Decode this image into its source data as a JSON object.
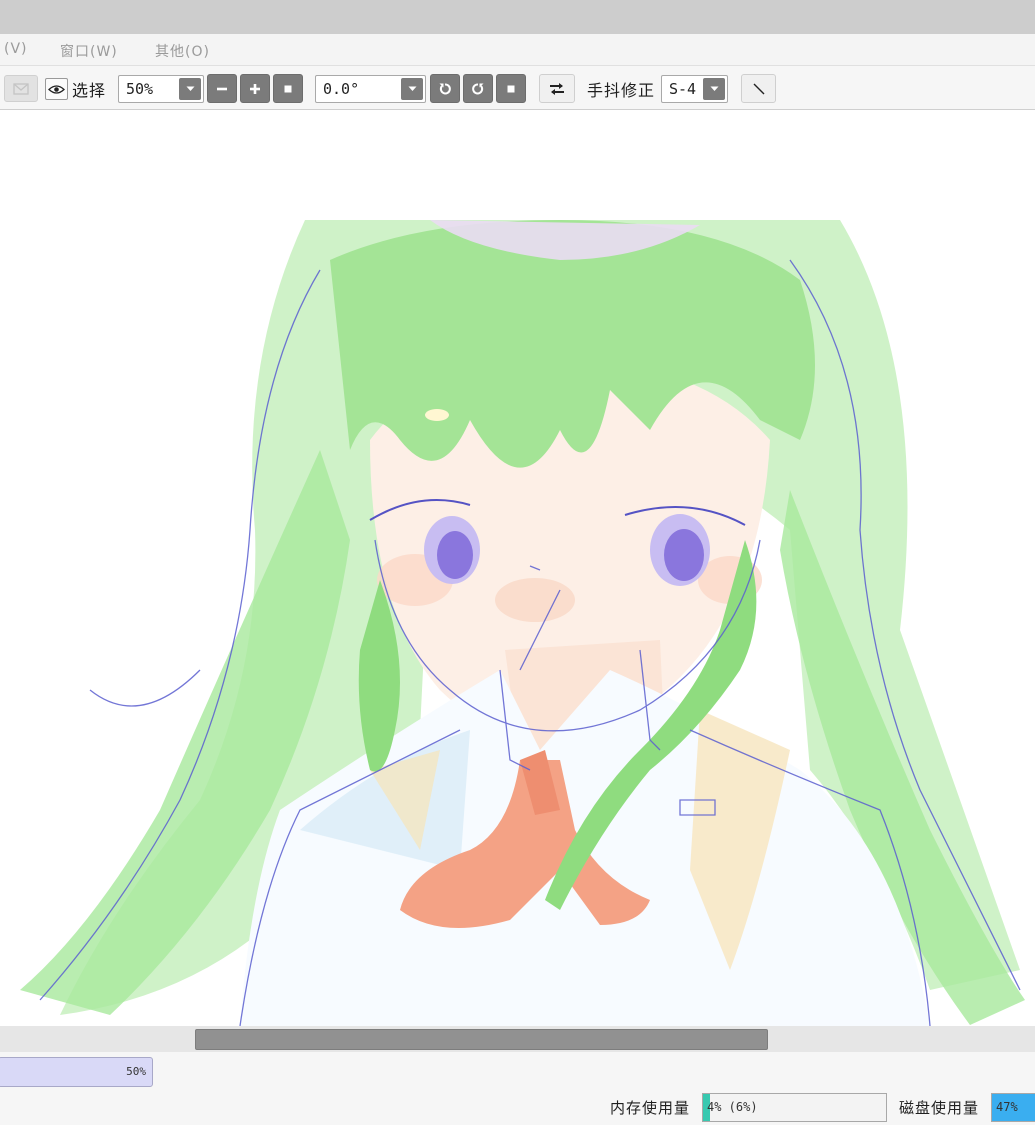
{
  "menu": {
    "view_label": "(V)",
    "window_label": "窗口(W)",
    "other_label": "其他(O)"
  },
  "toolbar": {
    "select_label": "选择",
    "zoom_value": "50%",
    "rotation_value": "0.0°",
    "stabilizer_label": "手抖修正",
    "stabilizer_value": "S-4"
  },
  "statusbar": {
    "zoom_value": "50%",
    "memory_label": "内存使用量",
    "memory_value": "4% (6%)",
    "memory_usage_percent": 4,
    "disk_label": "磁盘使用量",
    "disk_value": "47%",
    "disk_usage_percent": 47
  },
  "colors": {
    "memory_fill": "#37c9b0",
    "disk_fill": "#3aaef0",
    "zoom_bar": "#d9d9f7",
    "hair": "#b8ecae",
    "bow": "#f4a285",
    "eyes": "#9b87e3"
  },
  "canvas": {
    "subject": "anime-girl-illustration"
  }
}
